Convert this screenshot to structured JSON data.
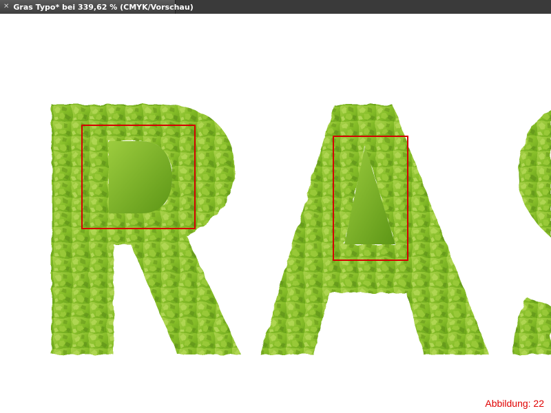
{
  "document_tab": {
    "title": "Gras Typo* bei 339,62 % (CMYK/Vorschau)",
    "close_icon": "close-icon"
  },
  "canvas": {
    "artwork_text": "RAS",
    "fill_colors": {
      "light": "#a9d14a",
      "mid": "#88bf2a",
      "dark": "#4f8a12"
    },
    "highlight_color": "#d40000"
  },
  "figure_caption": "Abbildung: 22"
}
